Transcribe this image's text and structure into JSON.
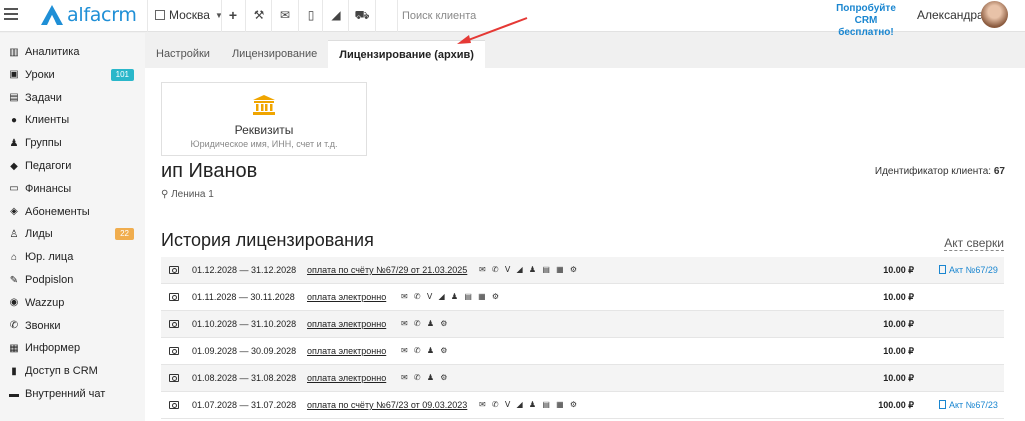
{
  "header": {
    "logo": "alfacrm",
    "city": "Москва",
    "search_placeholder": "Поиск клиента",
    "promo_line1": "Попробуйте",
    "promo_line2": "CRM бесплатно!",
    "user_name": "Александра"
  },
  "sidebar": {
    "items": [
      {
        "label": "Аналитика",
        "icon": "chart-icon"
      },
      {
        "label": "Уроки",
        "icon": "calendar-icon",
        "badge": "101",
        "badge_color": "#2ab7ca"
      },
      {
        "label": "Задачи",
        "icon": "tasks-icon"
      },
      {
        "label": "Клиенты",
        "icon": "user-icon"
      },
      {
        "label": "Группы",
        "icon": "users-icon"
      },
      {
        "label": "Педагоги",
        "icon": "graduation-cap-icon"
      },
      {
        "label": "Финансы",
        "icon": "money-icon"
      },
      {
        "label": "Абонементы",
        "icon": "tag-icon"
      },
      {
        "label": "Лиды",
        "icon": "user-plus-icon",
        "badge": "22",
        "badge_color": "#f0ad4e"
      },
      {
        "label": "Юр. лица",
        "icon": "bank-icon"
      },
      {
        "label": "Podpislon",
        "icon": "pen-icon"
      },
      {
        "label": "Wazzup",
        "icon": "whatsapp-icon"
      },
      {
        "label": "Звонки",
        "icon": "phone-icon"
      },
      {
        "label": "Информер",
        "icon": "info-icon"
      },
      {
        "label": "Доступ в CRM",
        "icon": "lock-icon"
      },
      {
        "label": "Внутренний чат",
        "icon": "chat-icon"
      }
    ]
  },
  "tabs": [
    {
      "label": "Настройки",
      "active": false
    },
    {
      "label": "Лицензирование",
      "active": false
    },
    {
      "label": "Лицензирование (архив)",
      "active": true
    }
  ],
  "requisites": {
    "title": "Реквизиты",
    "subtitle": "Юридическое имя, ИНН, счет и т.д."
  },
  "client": {
    "name": "ип Иванов",
    "address": "Ленина 1",
    "id_label": "Идентификатор клиента:",
    "id_value": "67"
  },
  "history": {
    "title": "История лицензирования",
    "reconciliation_link": "Акт сверки",
    "rows": [
      {
        "period": "01.12.2028 — 31.12.2028",
        "payment": "оплата по счёту №67/29 от 21.03.2025",
        "icons": "✉ ✆ ᐯ ◢ ♟ ▤ ▦ ⚙",
        "amount": "10.00 ₽",
        "act": "Акт №67/29"
      },
      {
        "period": "01.11.2028 — 30.11.2028",
        "payment": "оплата электронно",
        "icons": "✉ ✆ ᐯ ◢ ♟ ▤ ▦ ⚙",
        "amount": "10.00 ₽",
        "act": ""
      },
      {
        "period": "01.10.2028 — 31.10.2028",
        "payment": "оплата электронно",
        "icons": "✉ ✆ ♟ ⚙",
        "amount": "10.00 ₽",
        "act": ""
      },
      {
        "period": "01.09.2028 — 30.09.2028",
        "payment": "оплата электронно",
        "icons": "✉ ✆ ♟ ⚙",
        "amount": "10.00 ₽",
        "act": ""
      },
      {
        "period": "01.08.2028 — 31.08.2028",
        "payment": "оплата электронно",
        "icons": "✉ ✆ ♟ ⚙",
        "amount": "10.00 ₽",
        "act": ""
      },
      {
        "period": "01.07.2028 — 31.07.2028",
        "payment": "оплата по счёту №67/23 от 09.03.2023",
        "icons": "✉ ✆ ᐯ ◢ ♟ ▤ ▦ ⚙",
        "amount": "100.00 ₽",
        "act": "Акт №67/23"
      }
    ]
  },
  "colors": {
    "brand": "#1f8fd6",
    "link": "#1a86d0",
    "arrow": "#e53935",
    "bank_icon": "#f0a500"
  }
}
